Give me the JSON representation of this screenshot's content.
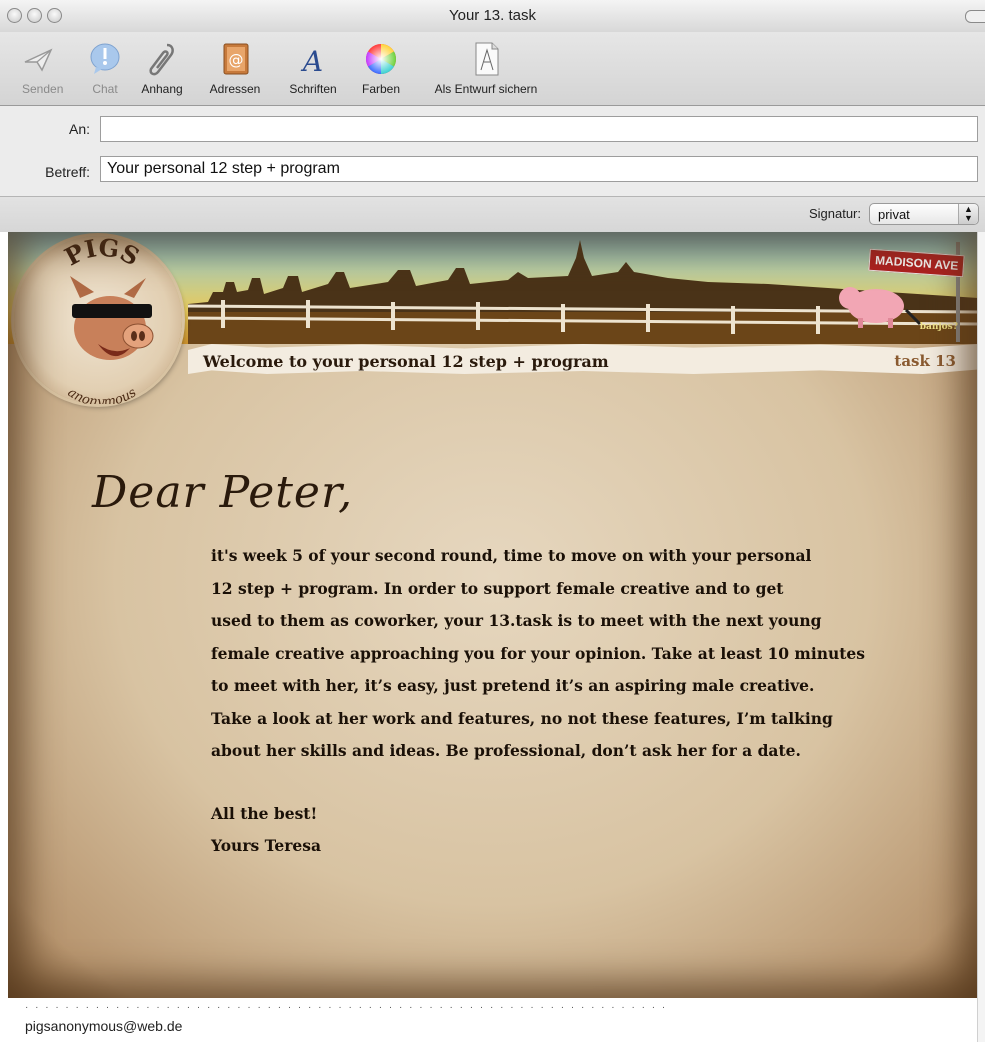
{
  "window": {
    "title": "Your 13. task"
  },
  "toolbar": {
    "items": [
      {
        "label": "Senden",
        "icon": "send-icon",
        "enabled": false
      },
      {
        "label": "Chat",
        "icon": "chat-icon",
        "enabled": false
      },
      {
        "label": "Anhang",
        "icon": "paperclip-icon",
        "enabled": true
      },
      {
        "label": "Adressen",
        "icon": "address-book-icon",
        "enabled": true
      },
      {
        "label": "Schriften",
        "icon": "fonts-icon",
        "enabled": true
      },
      {
        "label": "Farben",
        "icon": "color-wheel-icon",
        "enabled": true
      },
      {
        "label": "Als Entwurf sichern",
        "icon": "draft-icon",
        "enabled": true
      }
    ]
  },
  "fields": {
    "to_label": "An:",
    "to_value": "",
    "subject_label": "Betreff:",
    "subject_value": "Your personal 12 step + program"
  },
  "signature": {
    "label": "Signatur:",
    "value": "privat"
  },
  "letter": {
    "logo_top": "PIGS",
    "logo_bottom": "anonymous",
    "street_sign": "MADISON AVE",
    "tagline": "banjos?",
    "welcome": "Welcome to your personal 12  step + program",
    "task_tag": "task 13",
    "salutation": "Dear Peter,",
    "body_lines": [
      "it's week 5 of your second round, time to move on with your personal",
      "12 step + program. In order to support female creative and to get",
      "used to them as coworker, your 13.task is to meet with the next young",
      "female creative approaching you for your opinion. Take at least 10 minutes",
      "to meet with her, it’s easy, just pretend it’s an aspiring male creative.",
      "Take a look at her work and features, no not these features, I’m talking",
      "about her skills and ideas. Be professional, don’t ask her for a date."
    ],
    "closing": "All the best!",
    "sender": "Yours Teresa"
  },
  "footer": {
    "email": "pigsanonymous@web.de"
  }
}
